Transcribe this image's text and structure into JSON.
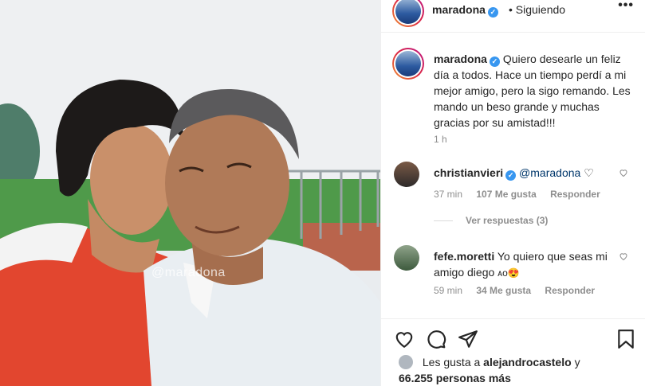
{
  "watermark": "@maradona",
  "header": {
    "username": "maradona",
    "verified_icon": "verified-badge-icon",
    "follow_status": "• Siguiendo",
    "more": "•••"
  },
  "caption": {
    "username": "maradona",
    "text": "Quiero desearle un feliz día a todos. Hace un tiempo perdí a mi mejor amigo, pero la sigo remando. Les mando un beso grande y muchas gracias por su amistad!!!",
    "time": "1 h"
  },
  "comments": [
    {
      "username": "christianvieri",
      "text": "@maradona",
      "emoji": "♡",
      "time": "37 min",
      "likes": "107 Me gusta",
      "reply": "Responder",
      "replies_label": "Ver respuestas (3)"
    },
    {
      "username": "fefe.moretti",
      "text": "Yo quiero que seas mi amigo diego",
      "emoji": "ᴀᴏ😍",
      "time": "59 min",
      "likes": "34 Me gusta",
      "reply": "Responder"
    }
  ],
  "likes_summary": {
    "prefix": "Les gusta a",
    "user": "alejandrocastelo",
    "suffix": "y",
    "count": "66.255 personas más"
  },
  "colors": {
    "verified": "#3897f0",
    "text": "#262626",
    "muted": "#8e8e8e"
  }
}
